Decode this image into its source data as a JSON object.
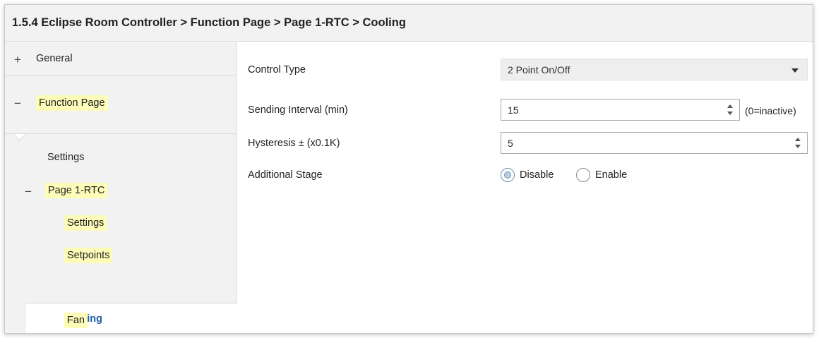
{
  "breadcrumb": "1.5.4 Eclipse Room Controller > Function Page > Page 1-RTC > Cooling",
  "sidebar": {
    "general": {
      "symbol": "+",
      "label": "General"
    },
    "function_page": {
      "symbol": "−",
      "label": "Function Page"
    },
    "settings": {
      "label": "Settings"
    },
    "page1": {
      "symbol": "−",
      "label": "Page 1-RTC"
    },
    "page1_settings": {
      "label": "Settings"
    },
    "page1_setpoints": {
      "label": "Setpoints"
    },
    "page1_cooling": {
      "label": "Cooling"
    },
    "page1_fan": {
      "label": "Fan"
    }
  },
  "params": {
    "control_type": {
      "label": "Control Type",
      "value": "2 Point On/Off"
    },
    "sending_interval": {
      "label": "Sending Interval (min)",
      "value": "15",
      "hint": "(0=inactive)"
    },
    "hysteresis": {
      "label": "Hysteresis ± (x0.1K)",
      "value": "5"
    },
    "additional_stage": {
      "label": "Additional Stage",
      "options": [
        "Disable",
        "Enable"
      ],
      "selected": "Disable"
    }
  },
  "colors": {
    "highlight": "#fdfcb8",
    "active_link": "#1f5fa8",
    "sidebar_bg": "#f2f2f2"
  }
}
